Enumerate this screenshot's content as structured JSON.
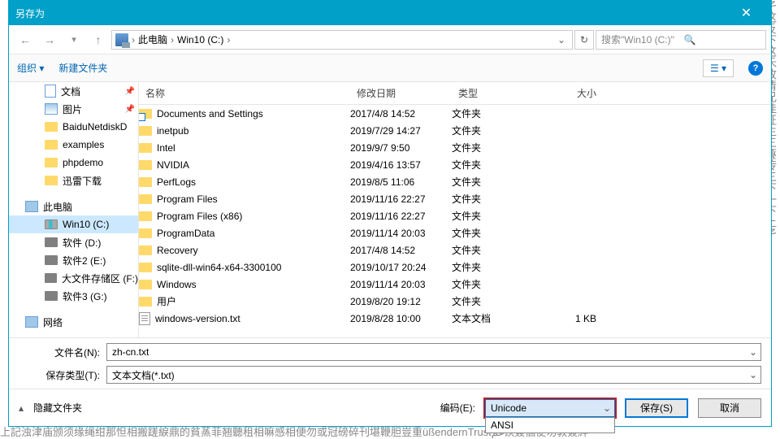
{
  "window": {
    "title": "另存为"
  },
  "nav": {
    "breadcrumb": [
      "此电脑",
      "Win10 (C:)"
    ],
    "search_placeholder": "搜索\"Win10 (C:)\""
  },
  "toolbar": {
    "organize": "组织",
    "new_folder": "新建文件夹"
  },
  "tree": {
    "items": [
      {
        "icon": "doc",
        "label": "文档",
        "pin": true,
        "indent": 1
      },
      {
        "icon": "pic",
        "label": "图片",
        "pin": true,
        "indent": 1
      },
      {
        "icon": "folder",
        "label": "BaiduNetdiskD",
        "indent": 1
      },
      {
        "icon": "folder",
        "label": "examples",
        "indent": 1
      },
      {
        "icon": "folder",
        "label": "phpdemo",
        "indent": 1
      },
      {
        "icon": "folder",
        "label": "迅雷下载",
        "indent": 1
      },
      {
        "spacer": true
      },
      {
        "icon": "pc",
        "label": "此电脑",
        "indent": 0
      },
      {
        "icon": "drive-c",
        "label": "Win10 (C:)",
        "indent": 1,
        "selected": true
      },
      {
        "icon": "drive",
        "label": "软件 (D:)",
        "indent": 1
      },
      {
        "icon": "drive",
        "label": "软件2 (E:)",
        "indent": 1
      },
      {
        "icon": "drive",
        "label": "大文件存储区 (F:)",
        "indent": 1
      },
      {
        "icon": "drive",
        "label": "软件3 (G:)",
        "indent": 1
      },
      {
        "spacer": true
      },
      {
        "icon": "pc",
        "label": "网络",
        "indent": 0
      }
    ]
  },
  "filelist": {
    "columns": {
      "name": "名称",
      "date": "修改日期",
      "type": "类型",
      "size": "大小"
    },
    "rows": [
      {
        "icon": "shortcut",
        "name": "Documents and Settings",
        "date": "2017/4/8 14:52",
        "type": "文件夹",
        "size": ""
      },
      {
        "icon": "folder",
        "name": "inetpub",
        "date": "2019/7/29 14:27",
        "type": "文件夹",
        "size": ""
      },
      {
        "icon": "folder",
        "name": "Intel",
        "date": "2019/9/7 9:50",
        "type": "文件夹",
        "size": ""
      },
      {
        "icon": "folder",
        "name": "NVIDIA",
        "date": "2019/4/16 13:57",
        "type": "文件夹",
        "size": ""
      },
      {
        "icon": "folder",
        "name": "PerfLogs",
        "date": "2019/8/5 11:06",
        "type": "文件夹",
        "size": ""
      },
      {
        "icon": "folder",
        "name": "Program Files",
        "date": "2019/11/16 22:27",
        "type": "文件夹",
        "size": ""
      },
      {
        "icon": "folder",
        "name": "Program Files (x86)",
        "date": "2019/11/16 22:27",
        "type": "文件夹",
        "size": ""
      },
      {
        "icon": "folder",
        "name": "ProgramData",
        "date": "2019/11/14 20:03",
        "type": "文件夹",
        "size": ""
      },
      {
        "icon": "folder",
        "name": "Recovery",
        "date": "2017/4/8 14:52",
        "type": "文件夹",
        "size": ""
      },
      {
        "icon": "folder",
        "name": "sqlite-dll-win64-x64-3300100",
        "date": "2019/10/17 20:24",
        "type": "文件夹",
        "size": ""
      },
      {
        "icon": "folder",
        "name": "Windows",
        "date": "2019/11/14 20:03",
        "type": "文件夹",
        "size": ""
      },
      {
        "icon": "folder",
        "name": "用户",
        "date": "2019/8/20 19:12",
        "type": "文件夹",
        "size": ""
      },
      {
        "icon": "txt",
        "name": "windows-version.txt",
        "date": "2019/8/28 10:00",
        "type": "文本文档",
        "size": "1 KB"
      }
    ]
  },
  "fields": {
    "filename_label": "文件名(N):",
    "filename_value": "zh-cn.txt",
    "filetype_label": "保存类型(T):",
    "filetype_value": "文本文档(*.txt)"
  },
  "bottom": {
    "hide_folders": "隐藏文件夹",
    "encoding_label": "编码(E):",
    "encoding_value": "Unicode",
    "encoding_option": "ANSI",
    "save": "保存(S)",
    "cancel": "取消"
  }
}
